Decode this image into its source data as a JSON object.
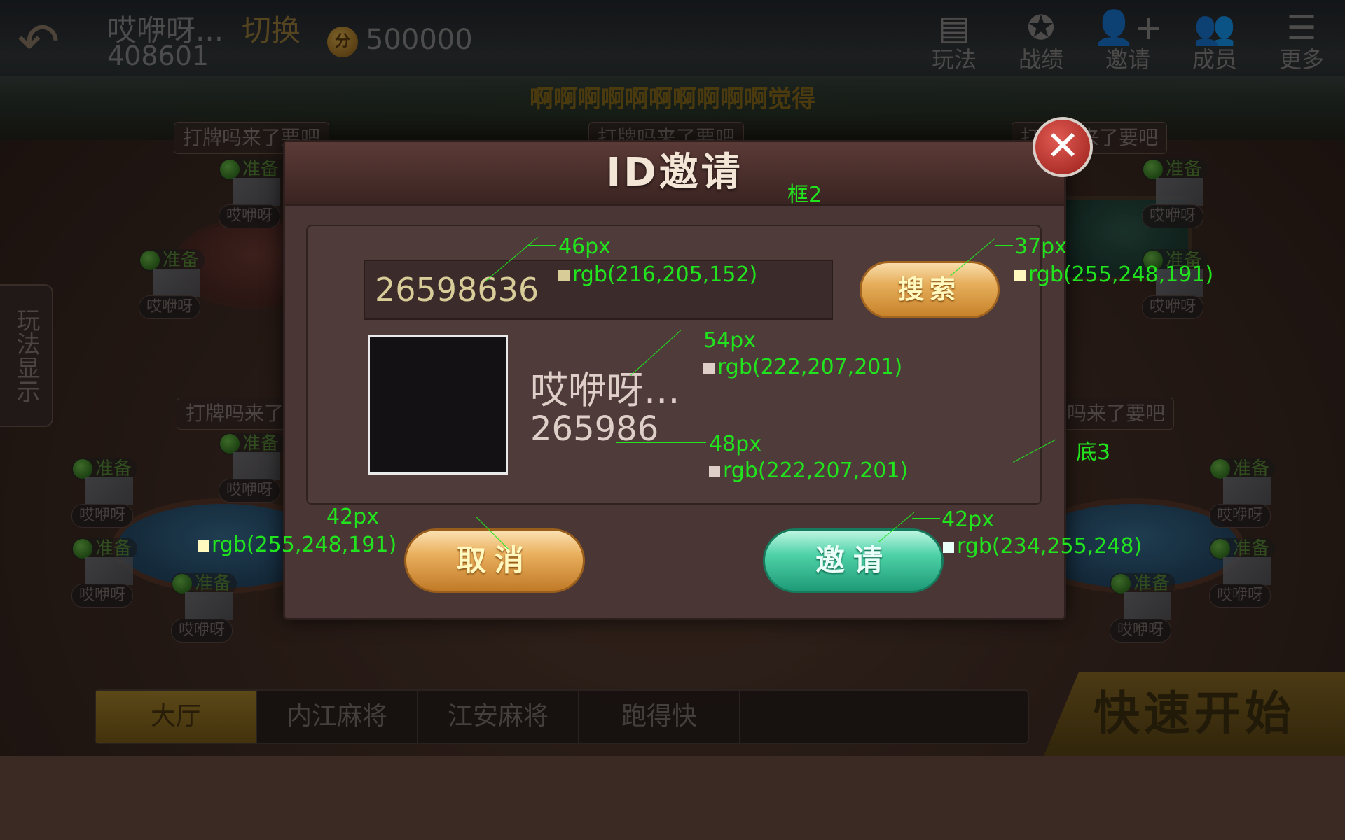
{
  "header": {
    "player_name": "哎咿呀...",
    "switch_label": "切换",
    "player_id": "408601",
    "coin_symbol": "分",
    "coin_value": "500000",
    "nav": [
      {
        "icon": "rules-icon",
        "glyph": "▤",
        "label": "玩法"
      },
      {
        "icon": "record-icon",
        "glyph": "✪",
        "label": "战绩"
      },
      {
        "icon": "invite-icon",
        "glyph": "👤+",
        "label": "邀请"
      },
      {
        "icon": "members-icon",
        "glyph": "👥",
        "label": "成员"
      },
      {
        "icon": "more-icon",
        "glyph": "☰",
        "label": "更多"
      }
    ]
  },
  "marquee": "啊啊啊啊啊啊啊啊啊啊觉得",
  "side_tab": "玩法显示",
  "rooms": {
    "titles": [
      "打牌吗来了要吧",
      "打牌吗来了要吧",
      "打牌吗来了要吧",
      "打牌吗来了",
      "吗来了要吧"
    ],
    "ready_label": "准备",
    "seat_name": "哎咿呀"
  },
  "bottom": {
    "tabs": [
      "大厅",
      "内江麻将",
      "江安麻将",
      "跑得快"
    ],
    "quick_start": "快速开始 ❯❯"
  },
  "dialog": {
    "title": "ID邀请",
    "close_glyph": "✕",
    "input_value": "26598636",
    "search_label": "搜索",
    "result_name": "哎咿呀...",
    "result_id": "265986",
    "cancel_label": "取消",
    "invite_label": "邀请"
  },
  "annotations": {
    "frame2": "框2",
    "base3": "底3",
    "input_size": "46px",
    "input_color": "rgb(216,205,152)",
    "search_size": "37px",
    "search_color": "rgb(255,248,191)",
    "name_size": "54px",
    "name_color": "rgb(222,207,201)",
    "id_size": "48px",
    "id_color": "rgb(222,207,201)",
    "cancel_size": "42px",
    "cancel_color": "rgb(255,248,191)",
    "invite_size": "42px",
    "invite_color": "rgb(234,255,248)",
    "colors": {
      "input": "#d8cd98",
      "search": "#fff8bf",
      "text": "#decfc9",
      "invite": "#eafff8",
      "guide": "#21e41e"
    }
  }
}
